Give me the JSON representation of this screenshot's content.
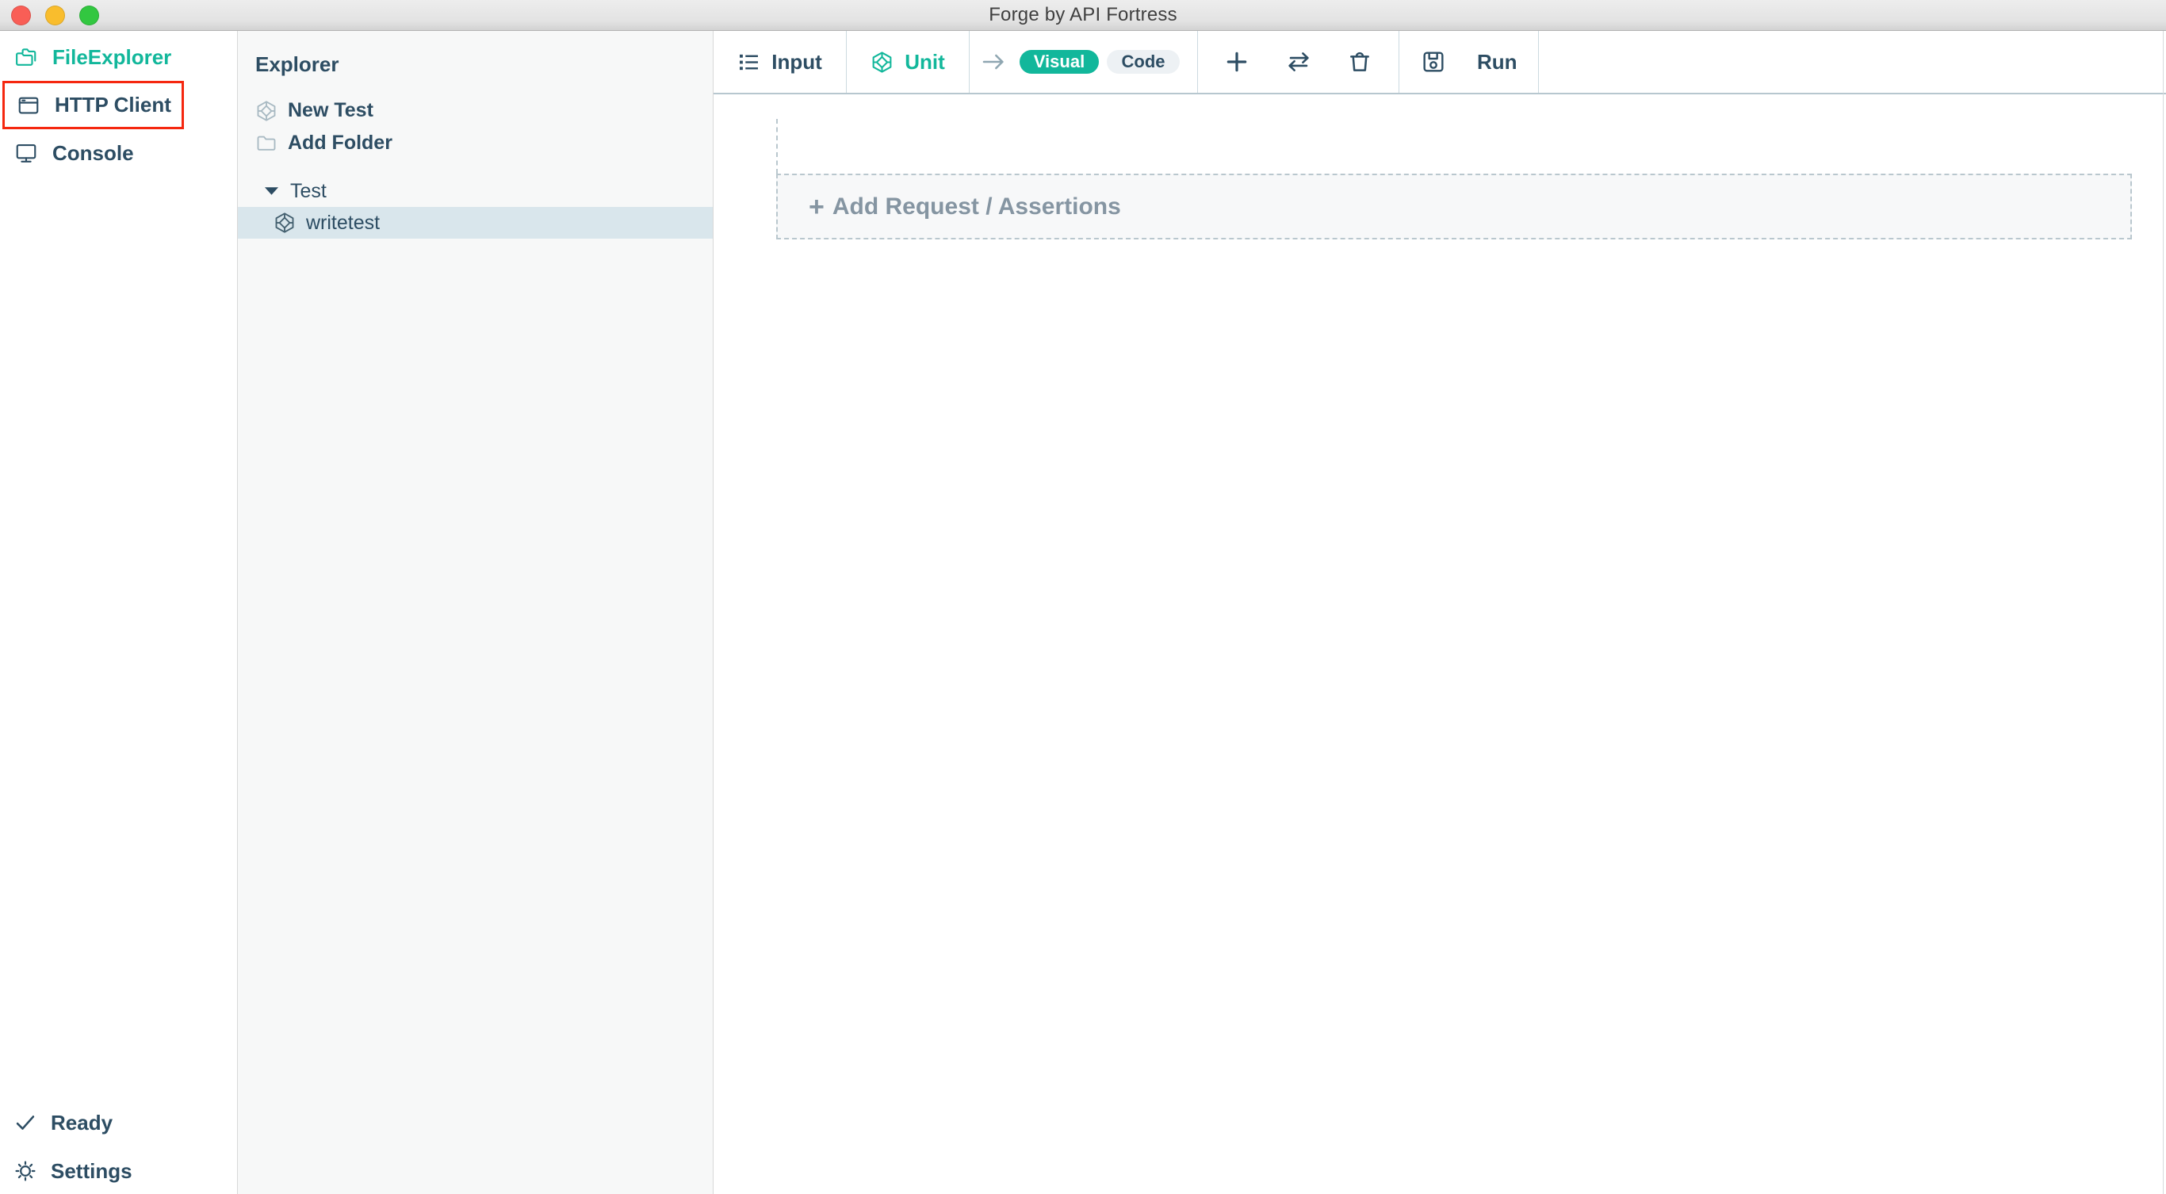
{
  "window": {
    "title": "Forge by API Fortress"
  },
  "titlebar_controls": [
    {
      "name": "close"
    },
    {
      "name": "minimize"
    },
    {
      "name": "zoom"
    }
  ],
  "sidebar": {
    "items": [
      {
        "label": "FileExplorer",
        "icon": "folders-icon",
        "active": true
      },
      {
        "label": "HTTP Client",
        "icon": "browser-icon",
        "highlighted": true
      },
      {
        "label": "Console",
        "icon": "monitor-icon"
      }
    ],
    "footer_items": [
      {
        "label": "Ready",
        "icon": "check-icon"
      },
      {
        "label": "Settings",
        "icon": "gear-icon"
      }
    ]
  },
  "explorer": {
    "title": "Explorer",
    "actions": [
      {
        "label": "New Test",
        "icon": "test-cube-icon"
      },
      {
        "label": "Add Folder",
        "icon": "folder-icon"
      }
    ],
    "tree": [
      {
        "label": "Test",
        "type": "folder",
        "expanded": true
      },
      {
        "label": "writetest",
        "type": "test",
        "selected": true
      }
    ]
  },
  "toolbar": {
    "tabs": [
      {
        "label": "Input",
        "icon": "list-icon"
      },
      {
        "label": "Unit",
        "icon": "cube-icon",
        "accent": true
      }
    ],
    "mode_toggle": {
      "options": [
        {
          "label": "Visual",
          "selected": true
        },
        {
          "label": "Code",
          "selected": false
        }
      ]
    },
    "actions": [
      {
        "name": "add",
        "icon": "plus-icon"
      },
      {
        "name": "reorder",
        "icon": "swap-arrows-icon"
      },
      {
        "name": "delete",
        "icon": "trash-icon"
      }
    ],
    "save_icon": "save-icon",
    "run_label": "Run"
  },
  "content": {
    "drop_zone_plus": "+",
    "drop_zone_label": "Add Request / Assertions"
  },
  "colors": {
    "accent": "#12b79b",
    "navy": "#2d4d63",
    "highlight_red": "#f5270f",
    "selected_row": "#d9e6ec",
    "panel_bg": "#f7f8f8",
    "toolbar_bottom": "#b7c7cf",
    "muted": "#8595a2"
  }
}
